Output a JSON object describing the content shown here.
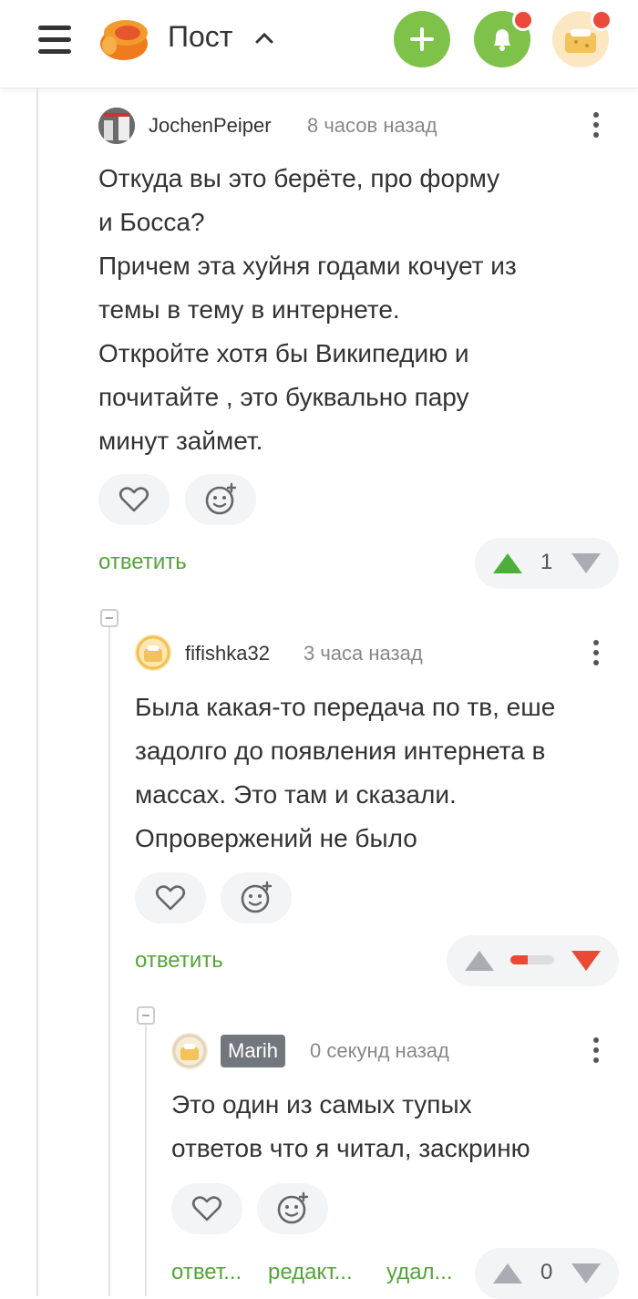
{
  "header": {
    "title": "Пост",
    "chevron_icon": "chevron-up-icon"
  },
  "comments": [
    {
      "author": "JochenPeiper",
      "time": "8 часов назад",
      "text": "Откуда вы это берёте, про форму\nи Босса?\nПричем эта хуйня годами кочует из\nтемы в тему в интернете.\nОткройте хотя бы Википедию и\nпочитайте , это буквально пару\nминут займет.",
      "reply_label": "ответить",
      "rating": "1"
    },
    {
      "author": "fifishka32",
      "time": "3 часа назад",
      "text": "Была какая-то передача по тв, еше\nзадолго до появления интернета в\nмассах. Это там и сказали.\nОпровержений не было",
      "reply_label": "ответить",
      "rating_bar": "negative"
    },
    {
      "author": "Marih",
      "time": "0 секунд назад",
      "text": "Это один из самых тупых\nответов что я читал, заскриню",
      "reply_label": "ответ...",
      "edit_label": "редакт...",
      "delete_label": "удал...",
      "rating": "0"
    }
  ],
  "colors": {
    "accent_green": "#7fc24a",
    "link_green": "#55a43a",
    "downvote_red": "#e84a33",
    "upvote_green": "#4caf3a"
  }
}
